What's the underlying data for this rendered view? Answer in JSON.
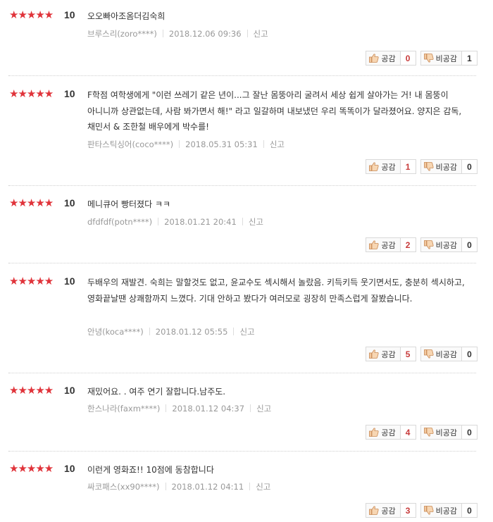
{
  "labels": {
    "stars": "★★★★★",
    "like": "공감",
    "dislike": "비공감",
    "report": "신고"
  },
  "colors": {
    "star": "#e0333a",
    "like_count": "#c73a3a",
    "dislike_count": "#333333"
  },
  "reviews": [
    {
      "rating": 5,
      "score": "10",
      "text": "오오빠아조옴더김숙희",
      "author": "브루스리(zoro****)",
      "date": "2018.12.06 09:36",
      "likes": "0",
      "dislikes": "1"
    },
    {
      "rating": 5,
      "score": "10",
      "text": "F학점 여학생에게 \"이런 쓰레기 같은 년이...그 잘난 몸뚱아리 굴려서 세상 쉽게 살아가는 거! 내 몸뚱이 아니니까 상관없는데, 사람 봐가면서 해!\" 라고 일갈하며 내보냈던 우리 똑똑이가 달라졌어요. 양지은 감독, 채민서 & 조한철 배우에게 박수를!",
      "author": "판타스틱싱어(coco****)",
      "date": "2018.05.31 05:31",
      "likes": "1",
      "dislikes": "0"
    },
    {
      "rating": 5,
      "score": "10",
      "text": "메니큐어 빵터졌다 ㅋㅋ",
      "author": "dfdfdf(potn****)",
      "date": "2018.01.21 20:41",
      "likes": "2",
      "dislikes": "0"
    },
    {
      "rating": 5,
      "score": "10",
      "text": "두배우의 재발견. 숙희는 말할것도 없고, 윤교수도 섹시해서 놀랐음. 키득키득 웃기면서도, 충분히 섹시하고, 영화끝날땐 상쾌함까지 느꼈다. 기대 안하고 봤다가 여러모로 굉장히 만족스럽게 잘봤습니다.",
      "author": "안녕(koca****)",
      "date": "2018.01.12 05:55",
      "likes": "5",
      "dislikes": "0"
    },
    {
      "rating": 5,
      "score": "10",
      "text": "재밌어요. . 여주 연기 잘합니다.남주도.",
      "author": "한스나라(faxm****)",
      "date": "2018.01.12 04:37",
      "likes": "4",
      "dislikes": "0"
    },
    {
      "rating": 5,
      "score": "10",
      "text": "이런게 영화죠!! 10점에 동참합니다",
      "author": "싸코패스(xx90****)",
      "date": "2018.01.12 04:11",
      "likes": "3",
      "dislikes": "0"
    }
  ]
}
